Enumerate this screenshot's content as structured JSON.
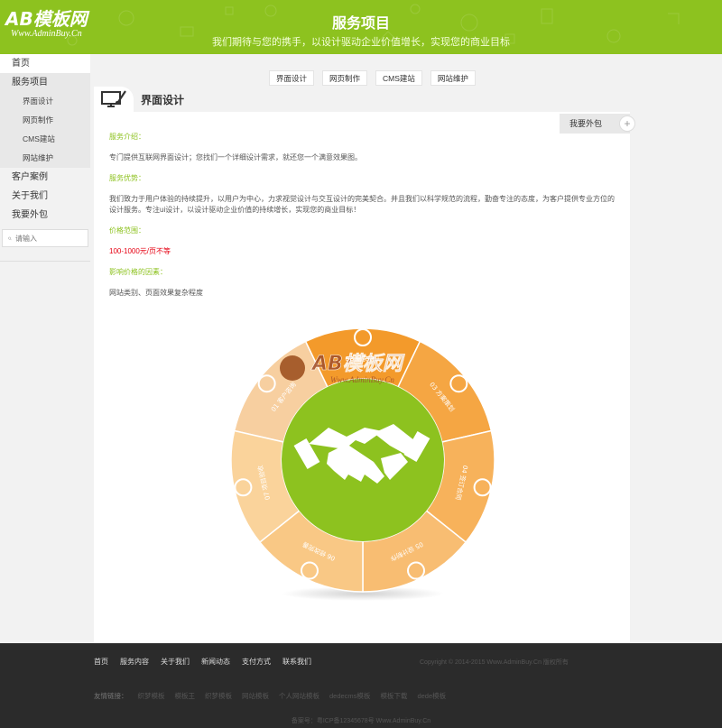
{
  "header": {
    "logo_main": "AB模板网",
    "logo_sub": "Www.AdminBuy.Cn",
    "title": "服务项目",
    "subtitle": "我们期待与您的携手，以设计驱动企业价值增长，实现您的商业目标"
  },
  "sidebar": {
    "items": [
      {
        "label": "首页"
      },
      {
        "label": "服务项目"
      },
      {
        "label": "界面设计"
      },
      {
        "label": "网页制作"
      },
      {
        "label": "CMS建站"
      },
      {
        "label": "网站维护"
      },
      {
        "label": "客户案例"
      },
      {
        "label": "关于我们"
      },
      {
        "label": "我要外包"
      }
    ],
    "search_placeholder": "请输入"
  },
  "tabs": [
    {
      "label": "界面设计"
    },
    {
      "label": "网页制作"
    },
    {
      "label": "CMS建站"
    },
    {
      "label": "网站维护"
    }
  ],
  "section": {
    "title": "界面设计",
    "outsource_button": "我要外包"
  },
  "article": {
    "intro_heading": "服务介绍：",
    "intro_text": "专门提供互联网界面设计；您找们一个详细设计需求，就还您一个满意效果图。",
    "advantage_heading": "服务优势：",
    "advantage_text": "我们致力于用户体验的持续提升，以用户为中心，力求视觉设计与交互设计的完美契合。并且我们以科学规范的流程，勤奋专注的态度，为客户提供专业方位的设计服务。专注ui设计，以设计驱动企业价值的持续增长，实现您的商业目标！",
    "price_heading": "价格范围：",
    "price_text": "100-1000元/页不等",
    "factor_heading": "影响价格的因素：",
    "factor_text": "网站类别、页面效果复杂程度"
  },
  "diagram": {
    "steps": [
      "01 客户咨询",
      "02 需求确认",
      "03 方案策划",
      "04 签订合同",
      "05 设计制作",
      "06 修改完善",
      "07 项目验收"
    ],
    "watermark_main": "AB模板网",
    "watermark_sub": "Www.AdminBuy.Cn"
  },
  "footer": {
    "nav": [
      "首页",
      "服务内容",
      "关于我们",
      "新闻动态",
      "支付方式",
      "联系我们"
    ],
    "copyright": "Copyright © 2014-2015 Www.AdminBuy.Cn 版权所有",
    "links_label": "友情链接：",
    "links": [
      "织梦模板",
      "模板王",
      "织梦模板",
      "网站模板",
      "个人网站模板",
      "dedecms模板",
      "模板下载",
      "dede模板"
    ],
    "icp": "备案号：粤ICP备12345678号 Www.AdminBuy.Cn"
  },
  "colors": {
    "brand_green": "#8dc21f",
    "orange": "#f39a2b",
    "light_orange": "#f7bf7a",
    "price_red": "#e60012",
    "footer_bg": "#2b2b2b"
  },
  "icons": [
    "monitor-brush-icon",
    "search-icon",
    "plus-circle-icon",
    "handshake-icon"
  ]
}
